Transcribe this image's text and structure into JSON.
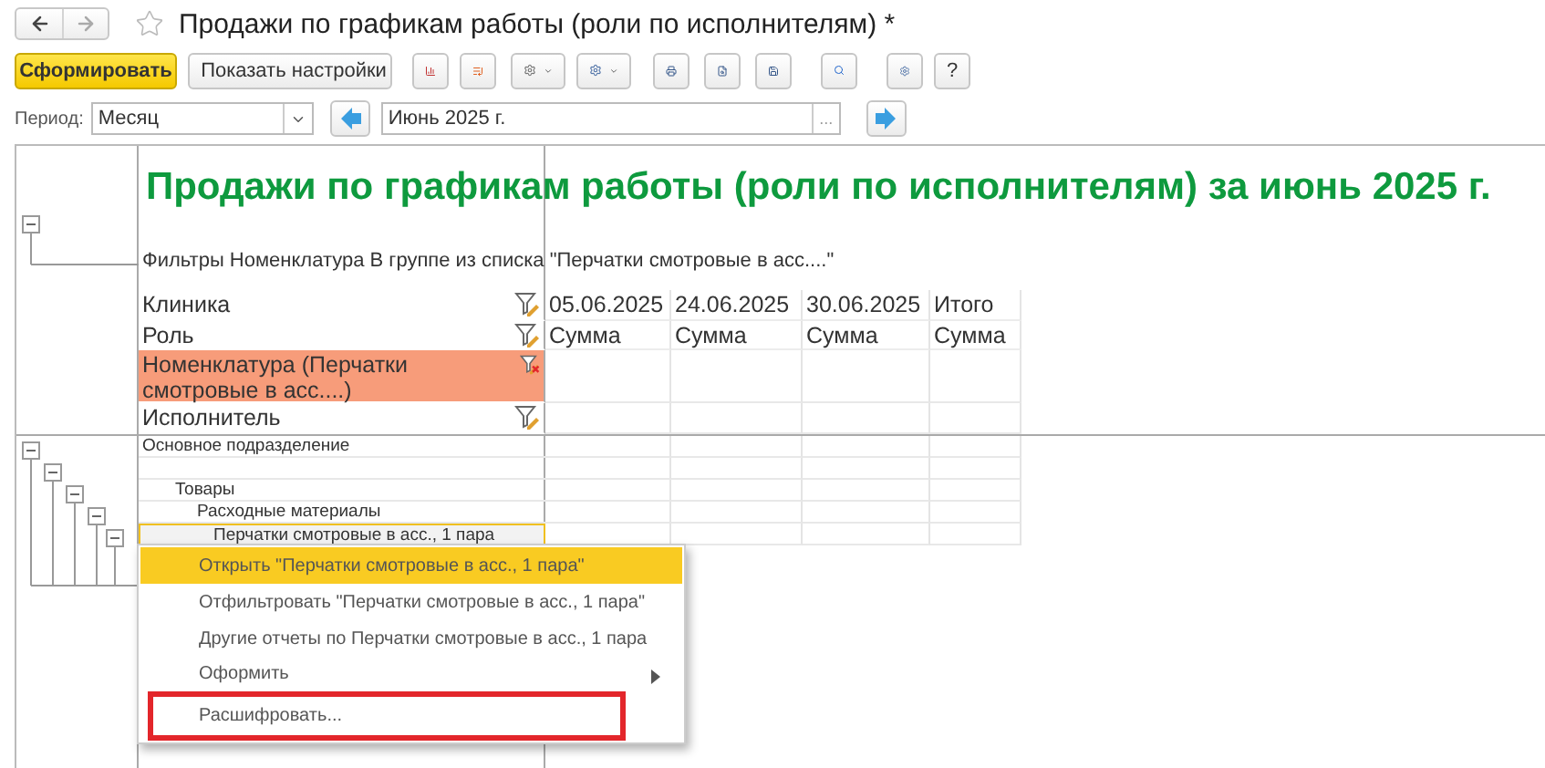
{
  "window": {
    "title": "Продажи по графикам работы (роли по исполнителям) *",
    "favorite": false
  },
  "toolbar": {
    "generate_button": "Сформировать",
    "settings_button": "Показать настройки",
    "help_button": "?"
  },
  "period": {
    "label": "Период:",
    "type": "Месяц",
    "value": "Июнь 2025 г.",
    "browse": "..."
  },
  "report": {
    "title": "Продажи по графикам работы (роли по исполнителям) за июнь 2025 г.",
    "filters": "Фильтры Номенклатура В группе из списка \"Перчатки смотровые в асс....\"",
    "header_fields": [
      {
        "label": "Клиника",
        "highlighted": false
      },
      {
        "label": "Роль",
        "highlighted": false
      },
      {
        "label": "Номенклатура (Перчатки смотровые в асс....)",
        "highlighted": true
      },
      {
        "label": "Исполнитель",
        "highlighted": false
      }
    ],
    "columns": [
      {
        "date": "05.06.2025",
        "measure": "Сумма"
      },
      {
        "date": "24.06.2025",
        "measure": "Сумма"
      },
      {
        "date": "30.06.2025",
        "measure": "Сумма"
      },
      {
        "date": "Итого",
        "measure": "Сумма"
      }
    ],
    "rows": [
      {
        "label": "Основное подразделение",
        "selected": false,
        "children": [
          {
            "selected": false,
            "children": [
              {
                "label": "Товары",
                "selected": false,
                "children": [
                  {
                    "label": "Расходные материалы",
                    "selected": false,
                    "children": [
                      {
                        "label": "Перчатки смотровые в асс., 1 пара",
                        "selected": true
                      }
                    ]
                  }
                ]
              }
            ]
          }
        ]
      }
    ]
  },
  "context_menu": {
    "items": [
      {
        "label": "Открыть \"Перчатки смотровые в асс., 1 пара\"",
        "selected": true,
        "submenu": false,
        "marked": false
      },
      {
        "label": "Отфильтровать \"Перчатки смотровые в асс., 1 пара\"",
        "selected": false,
        "submenu": false,
        "marked": false
      },
      {
        "label": "Другие отчеты по Перчатки смотровые в асс., 1 пара",
        "selected": false,
        "submenu": false,
        "marked": false
      },
      {
        "label": "Оформить",
        "selected": false,
        "submenu": true,
        "marked": false
      },
      {
        "label": "Расшифровать...",
        "selected": false,
        "submenu": false,
        "marked": true
      }
    ]
  }
}
